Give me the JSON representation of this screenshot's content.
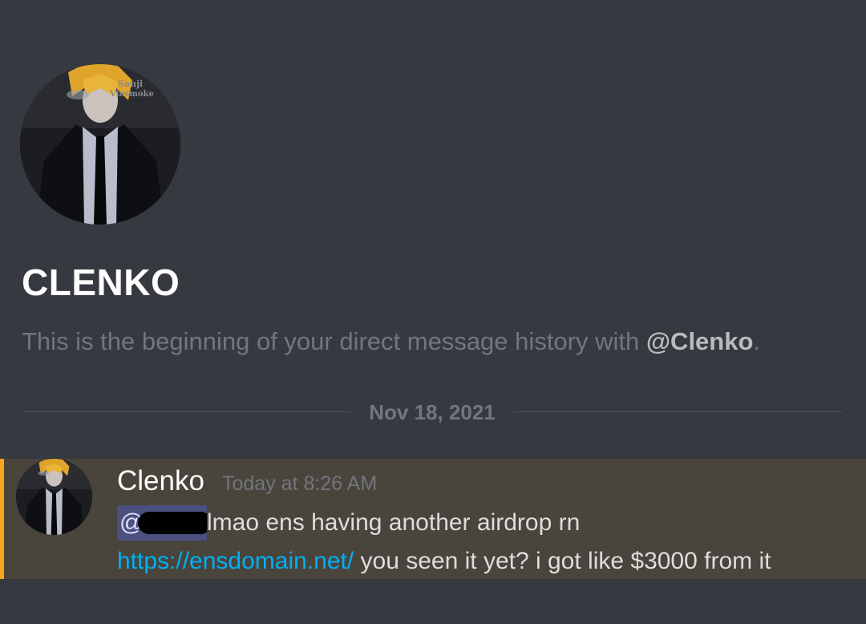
{
  "profile": {
    "name": "CLENKO",
    "intro_prefix": "This is the beginning of your direct message history with ",
    "intro_mention": "@Clenko",
    "intro_suffix": "."
  },
  "divider": {
    "date": "Nov 18, 2021"
  },
  "message": {
    "author": "Clenko",
    "timestamp": "Today at 8:26 AM",
    "mention_prefix": "@",
    "text_line1": "lmao ens having another airdrop rn",
    "link": "https://ensdomain.net/",
    "text_line2": " you seen it yet? i got like $3000 from it"
  },
  "avatar_watermark": [
    "Sanji",
    "Vinsmoke"
  ],
  "colors": {
    "background": "#36393f",
    "highlight_background": "#49443c",
    "highlight_bar": "#faa61a",
    "link": "#00b0f4",
    "mention_bg": "#4c5080",
    "muted_text": "#72767d"
  }
}
